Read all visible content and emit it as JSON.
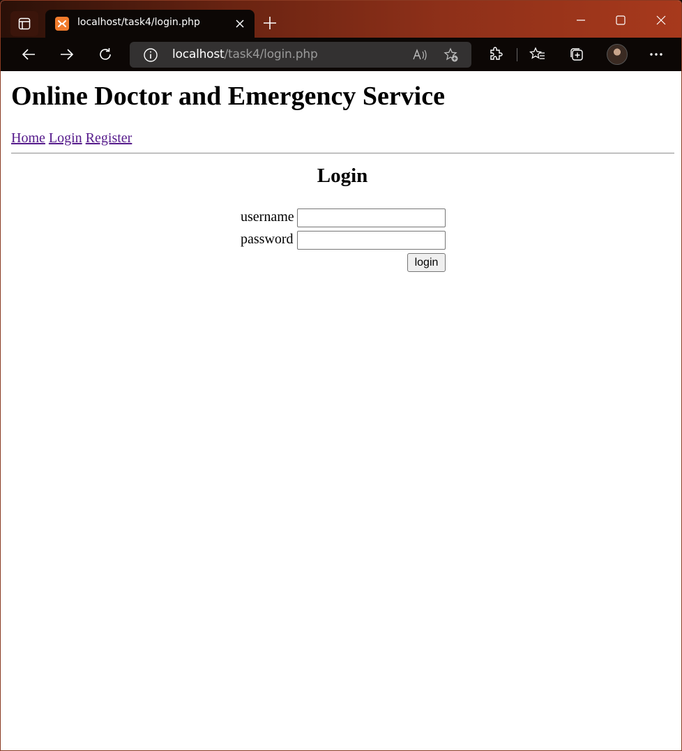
{
  "browser": {
    "tab": {
      "title": "localhost/task4/login.php",
      "favicon": "xampp-icon"
    },
    "address": {
      "host": "localhost",
      "path": "/task4/login.php"
    },
    "colors": {
      "tabstrip_accent": "#a7391c",
      "toolbar_bg": "#0c0705",
      "addressbar_bg": "#333131"
    }
  },
  "page": {
    "title": "Online Doctor and Emergency Service",
    "nav": {
      "home": "Home",
      "login": "Login",
      "register": "Register"
    },
    "login": {
      "heading": "Login",
      "username_label": "username",
      "password_label": "password",
      "username_value": "",
      "password_value": "",
      "submit_label": "login"
    },
    "colors": {
      "link_visited": "#551a8b"
    }
  }
}
